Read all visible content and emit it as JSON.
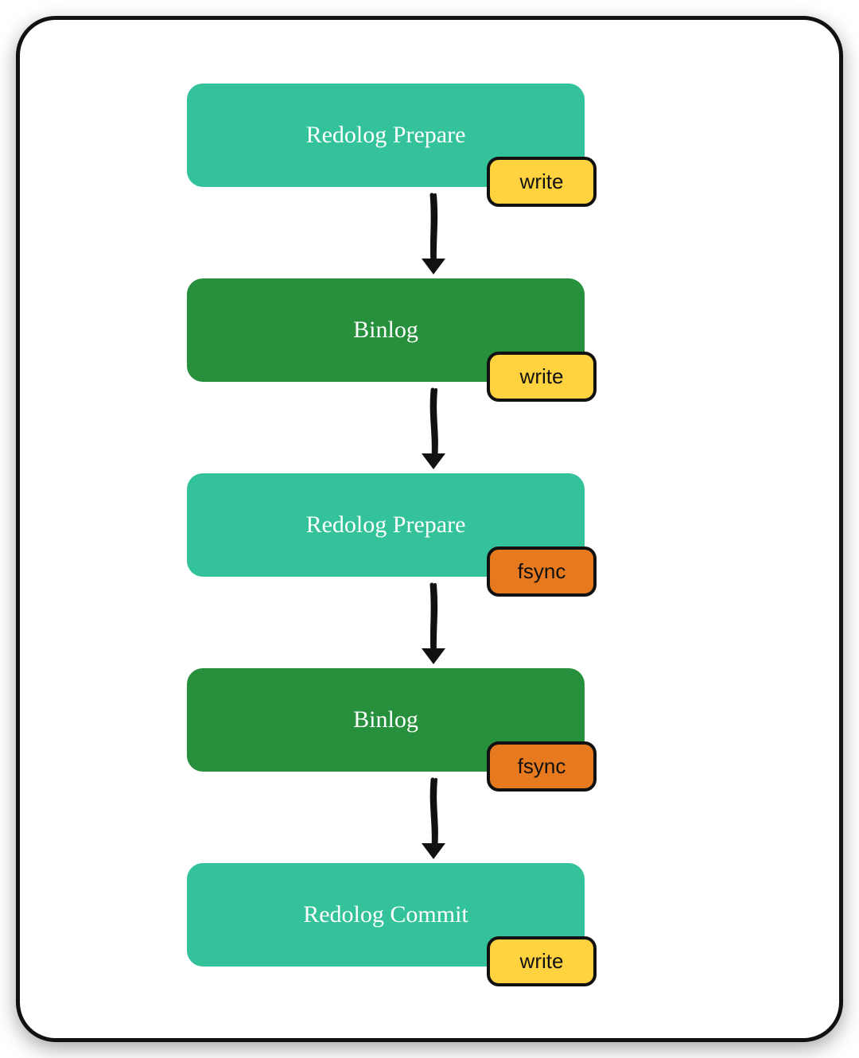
{
  "nodes": [
    {
      "label": "Redolog Prepare",
      "color": "light",
      "tag_text": "write",
      "tag_color": "yellow"
    },
    {
      "label": "Binlog",
      "color": "dark",
      "tag_text": "write",
      "tag_color": "yellow"
    },
    {
      "label": "Redolog Prepare",
      "color": "light",
      "tag_text": "fsync",
      "tag_color": "orange"
    },
    {
      "label": "Binlog",
      "color": "dark",
      "tag_text": "fsync",
      "tag_color": "orange"
    },
    {
      "label": "Redolog Commit",
      "color": "light",
      "tag_text": "write",
      "tag_color": "yellow"
    }
  ]
}
